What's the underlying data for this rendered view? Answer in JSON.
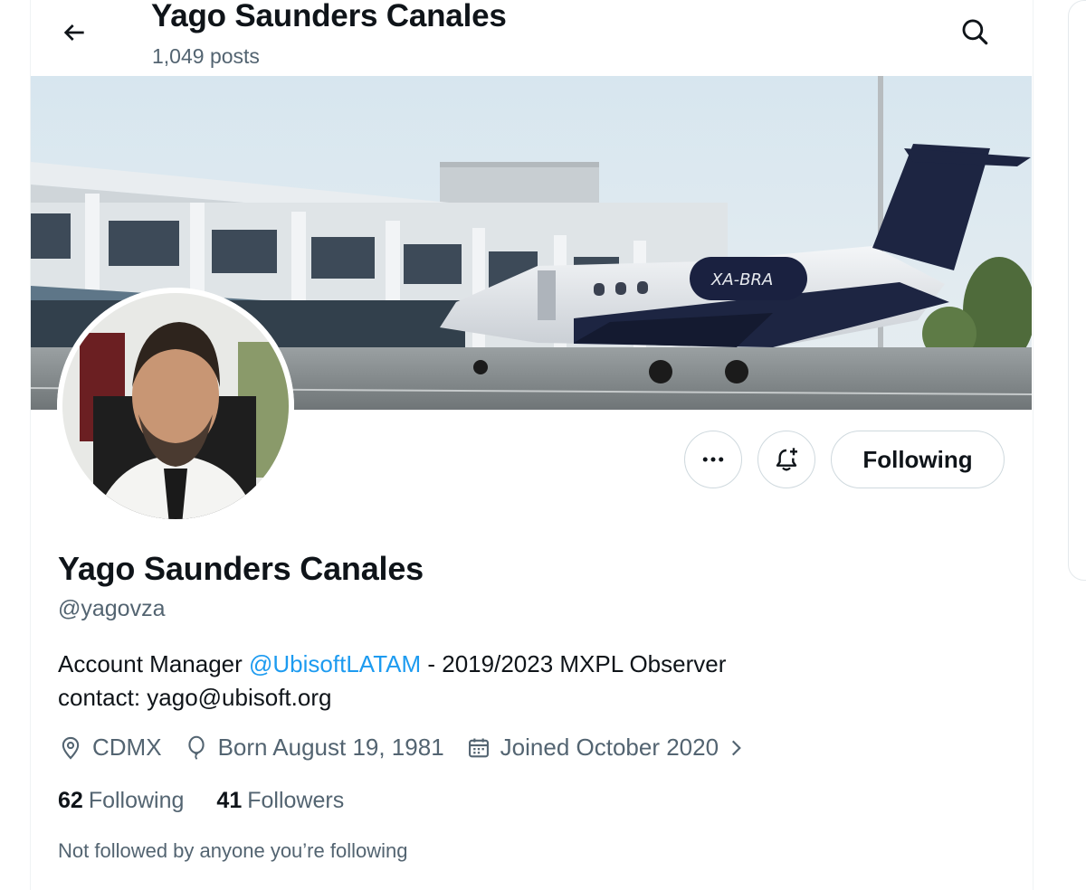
{
  "header": {
    "title": "Yago Saunders Canales",
    "posts_count": "1,049 posts",
    "back_icon": "arrow-left-icon",
    "search_icon": "search-icon"
  },
  "banner": {
    "description_icon": "banner-image",
    "plane_registration": "XA-BRA"
  },
  "actions": {
    "more_icon": "more-icon",
    "notify_icon": "bell-plus-icon",
    "follow_label": "Following"
  },
  "profile": {
    "name": "Yago Saunders Canales",
    "handle": "@yagovza",
    "bio_prefix": "Account Manager ",
    "bio_mention": "@UbisoftLATAM",
    "bio_suffix": " - 2019/2023 MXPL Observer",
    "bio_line2": "contact: yago@ubisoft.org",
    "location": "CDMX",
    "birthday": "Born August 19, 1981",
    "joined": "Joined October 2020",
    "following_count": "62",
    "following_label": "Following",
    "followers_count": "41",
    "followers_label": "Followers",
    "mutuals_note": "Not followed by anyone you’re following"
  },
  "colors": {
    "accent": "#1d9bf0",
    "text": "#0f1419",
    "secondary": "#536471",
    "border": "#cfd9de"
  }
}
